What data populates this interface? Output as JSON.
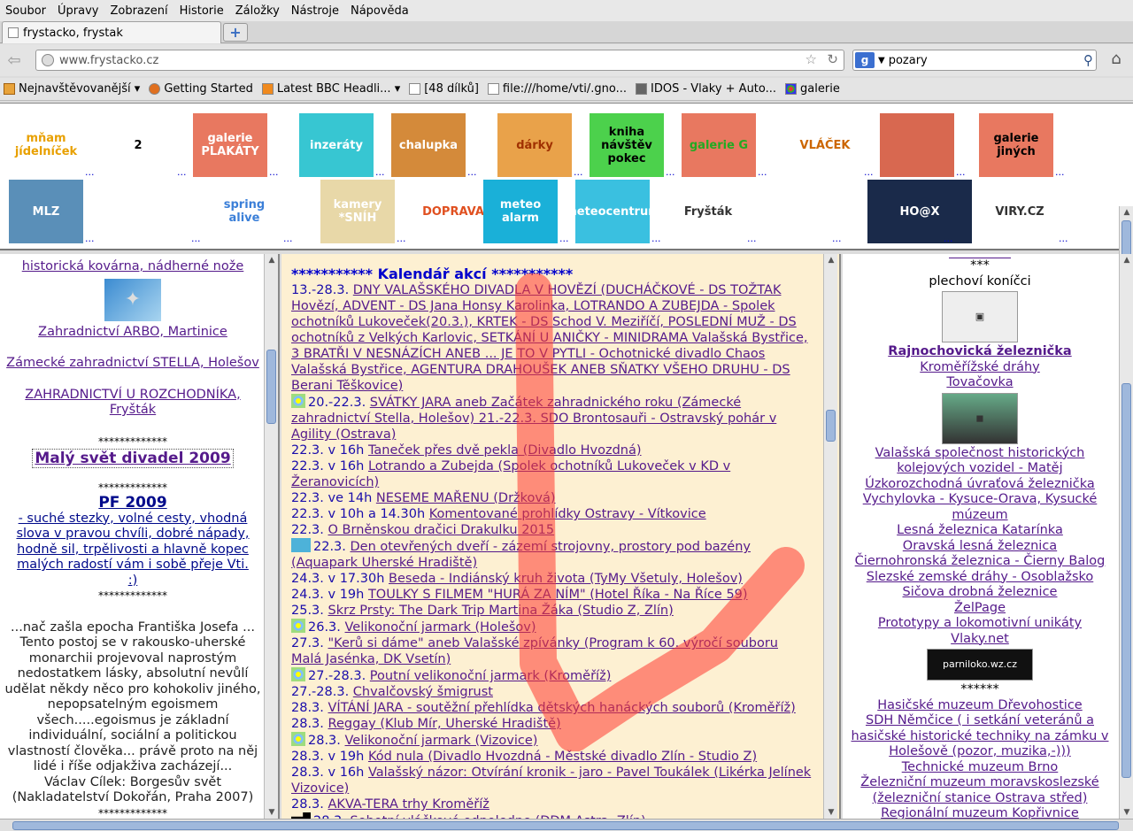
{
  "menu": [
    "Soubor",
    "Úpravy",
    "Zobrazení",
    "Historie",
    "Záložky",
    "Nástroje",
    "Nápověda"
  ],
  "tab": {
    "title": "frystacko, frystak",
    "new_tab": "+"
  },
  "nav": {
    "url": "www.frystacko.cz",
    "search_engine": "g",
    "search_query": "pozary"
  },
  "bookmarks": [
    {
      "label": "Nejnavštěvovanější ▾",
      "icon": "folder"
    },
    {
      "label": "Getting Started",
      "icon": "fox"
    },
    {
      "label": "Latest BBC Headli... ▾",
      "icon": "rss"
    },
    {
      "label": "[48 dílků]",
      "icon": "page"
    },
    {
      "label": "file:///home/vti/.gno...",
      "icon": "page"
    },
    {
      "label": "IDOS - Vlaky + Auto...",
      "icon": "idos"
    },
    {
      "label": "galerie",
      "icon": "gal"
    }
  ],
  "thumbs_row1": [
    {
      "label": "mňam jídelníček",
      "bg": "#ffffff",
      "fg": "#e8a000"
    },
    {
      "label": "2",
      "bg": "#ffffff",
      "fg": "#000"
    },
    {
      "label": "galerie PLAKÁTY",
      "bg": "#e87860",
      "fg": "#fff"
    },
    {
      "label": "inzeráty",
      "bg": "#37c6d2",
      "fg": "#fff"
    },
    {
      "label": "chalupka",
      "bg": "#d48a3a",
      "fg": "#fff"
    },
    {
      "label": "dárky",
      "bg": "#e9a24a",
      "fg": "#a03000"
    },
    {
      "label": "kniha návštěv pokec",
      "bg": "#4cd14c",
      "fg": "#000"
    },
    {
      "label": "galerie G",
      "bg": "#e87860",
      "fg": "#2a2"
    },
    {
      "label": "VLÁČEK",
      "bg": "#ffffff",
      "fg": "#c60"
    },
    {
      "label": "",
      "bg": "#d86850",
      "fg": "#fff"
    },
    {
      "label": "galerie jiných",
      "bg": "#e87860",
      "fg": "#000"
    }
  ],
  "thumbs_row2": [
    {
      "label": "MLZ",
      "bg": "#5a8fb8",
      "fg": "#fff"
    },
    {
      "label": "",
      "bg": "#ffffff",
      "fg": "#000"
    },
    {
      "label": "spring alive",
      "bg": "#ffffff",
      "fg": "#3b7fd8"
    },
    {
      "label": "kamery *SNÍH",
      "bg": "#e8d8a8",
      "fg": "#fff"
    },
    {
      "label": "DOPRAVA",
      "bg": "#ffffff",
      "fg": "#e05020"
    },
    {
      "label": "meteo alarm",
      "bg": "#1ab0d8",
      "fg": "#fff"
    },
    {
      "label": "meteocentrum",
      "bg": "#3ac0e0",
      "fg": "#fff"
    },
    {
      "label": "Fryšták",
      "bg": "#ffffff",
      "fg": "#333"
    },
    {
      "label": "",
      "bg": "#ffffff",
      "fg": "#e05020"
    },
    {
      "label": "HO@X",
      "bg": "#1a2a4a",
      "fg": "#fff"
    },
    {
      "label": "VIRY.CZ",
      "bg": "#ffffff",
      "fg": "#333"
    }
  ],
  "left": {
    "link1": "historická kovárna, nádherné nože",
    "link2": "Zahradnictví ARBO, Martinice",
    "link3": "Zámecké zahradnictví STELLA, Holešov",
    "link4": "ZAHRADNICTVÍ U ROZCHODNÍKA, Fryšták",
    "stars": "*************",
    "title1": "Malý svět divadel 2009",
    "title2": "PF 2009",
    "pf_text": "- suché stezky, volné cesty, vhodná slova v pravou chvíli, dobré nápady, hodně sil, trpělivosti a hlavně kopec malých radostí vám i sobě přeje Vti.",
    "smile": ":)",
    "quote": "...nač zašla epocha Františka Josefa ... Tento postoj se v rakousko-uherské monarchii projevoval naprostým nedostatkem lásky, absolutní nevůlí udělat někdy něco pro kohokoliv jiného, nepopsatelným egoismem všech.....egoismus je základní individuální, sociální a politickou vlastností člověka... právě proto na něj lidé i říše odjakživa zacházejí...",
    "author": "Václav Cílek: Borgesův svět (Nakladatelství Dokořán, Praha 2007)",
    "stars2": "*************"
  },
  "mid": {
    "heading": "*********** Kalendář akcí ***********",
    "events": [
      {
        "icon": "",
        "date": "13.-28.3.",
        "text": "DNY VALAŠSKÉHO DIVADLA V HOVĚZÍ (DUCHÁČKOVÉ - DS TOŽTAK Hovězí, ADVENT - DS Jana Honsy Karolinka, LOTRANDO A ZUBEJDA - Spolek ochotníků Lukoveček(20.3.), KRTEK - DS Schod V. Meziříčí, POSLEDNÍ MUŽ - DS ochotníků z Velkých Karlovic, SETKÁNÍ U ANIČKY - MINIDRAMA Valašská Bystřice, 3 BRATŘI V NESNÁZÍCH ANEB ... JE TO V PYTLI - Ochotnické divadlo Chaos Valašská Bystřice, AGENTURA DRAHOUŠEK ANEB SŇATKY VŠEHO DRUHU - DS Berani Těškovice)"
      },
      {
        "icon": "flower",
        "date": "20.-22.3.",
        "text": "SVÁTKY JARA aneb Začátek zahradnického roku (Zámecké zahradnictví Stella, Holešov) 21.-22.3. SDO Brontosauři - Ostravský pohár v Agility (Ostrava)"
      },
      {
        "icon": "",
        "date": "22.3. v 16h",
        "text": "Taneček přes dvě pekla (Divadlo Hvozdná)"
      },
      {
        "icon": "",
        "date": "22.3. v 16h",
        "text": "Lotrando a Zubejda (Spolek ochotníků Lukoveček v KD v Žeranovicích)"
      },
      {
        "icon": "",
        "date": "22.3. ve 14h",
        "text": "NESEME MAŘENU (Držková)"
      },
      {
        "icon": "",
        "date": "22.3. v 10h a 14.30h",
        "text": "Komentované prohlídky Ostravy - Vítkovice"
      },
      {
        "icon": "",
        "date": "22.3.",
        "text": "O Brněnskou dračici Drakulku 2015"
      },
      {
        "icon": "square",
        "date": "22.3.",
        "text": "Den otevřených dveří - zázemí strojovny, prostory pod bazény (Aquapark Uherské Hradiště)"
      },
      {
        "icon": "",
        "date": "24.3. v 17.30h",
        "text": "Beseda - Indiánský kruh života (TyMy Všetuly, Holešov)"
      },
      {
        "icon": "",
        "date": "24.3. v 19h",
        "text": "TOULKY S FILMEM \"HURÁ ZA NÍM\" (Hotel Říka - Na Říce 59)"
      },
      {
        "icon": "",
        "date": "25.3.",
        "text": "Skrz Prsty: The Dark Trip Martina Žáka (Studio Z, Zlín)"
      },
      {
        "icon": "flower",
        "date": "26.3.",
        "text": "Velikonoční jarmark (Holešov)"
      },
      {
        "icon": "",
        "date": "27.3.",
        "text": "\"Kerů si dáme\" aneb Valašské zpívánky (Program k 60. výročí souboru Malá Jasénka, DK Vsetín)"
      },
      {
        "icon": "flower",
        "date": "27.-28.3.",
        "text": "Poutní velikonoční jarmark (Kroměříž)"
      },
      {
        "icon": "",
        "date": "27.-28.3.",
        "text": "Chvalčovský šmigrust"
      },
      {
        "icon": "",
        "date": "28.3.",
        "text": "VÍTÁNÍ JARA - soutěžní přehlídka dětských hanáckých souborů (Kroměříž)"
      },
      {
        "icon": "",
        "date": "28.3.",
        "text": "Reggay (Klub Mír, Uherské Hradiště)"
      },
      {
        "icon": "flower",
        "date": "28.3.",
        "text": "Velikonoční jarmark (Vizovice)"
      },
      {
        "icon": "",
        "date": "28.3. v 19h",
        "text": "Kód nula (Divadlo Hvozdná - Městské divadlo Zlín - Studio Z)"
      },
      {
        "icon": "",
        "date": "28.3. v 16h",
        "text": "Valašský názor: Otvírání kronik - jaro - Pavel Toukálek (Likérka Jelínek Vizovice)"
      },
      {
        "icon": "",
        "date": "28.3.",
        "text": "AKVA-TERA trhy Kroměříž"
      },
      {
        "icon": "train",
        "date": "28.3.",
        "text": "Sobotní vláčkové odpoledne (DDM Astra, Zlín)"
      }
    ]
  },
  "right": {
    "stars": "***",
    "sub": "plechoví koníčci",
    "items": [
      {
        "text": "Rajnochovická železnička",
        "bold": true
      },
      {
        "text": "Kroměřížské dráhy",
        "bold": false
      },
      {
        "text": "Tovačovka",
        "bold": false
      },
      {
        "text": "Valašská společnost historických kolejových vozidel - Matěj",
        "bold": false
      },
      {
        "text": "Úzkorozchodná úvraťová železnička Vychylovka - Kysuce-Orava, Kysucké múzeum",
        "bold": false
      },
      {
        "text": "Lesná železnica Katarínka",
        "bold": false
      },
      {
        "text": "Oravská lesná železnica",
        "bold": false
      },
      {
        "text": "Čiernohronská železnica - Čierny Balog",
        "bold": false
      },
      {
        "text": "Slezské zemské dráhy - Osoblažsko",
        "bold": false
      },
      {
        "text": "Sičova drobná železnice",
        "bold": false
      },
      {
        "text": "ŽelPage",
        "bold": false
      },
      {
        "text": "Prototypy a lokomotivní unikáty",
        "bold": false
      },
      {
        "text": "Vlaky.net",
        "bold": false
      }
    ],
    "badge": "parniloko.wz.cz",
    "stars2": "******",
    "items2": [
      "Hasičské muzeum Dřevohostice",
      "SDH Němčice ( i setkání veteránů a hasičské historické techniky na zámku v Holešově (pozor, muzika,-)))",
      "Technické muzeum Brno",
      "Železniční muzeum moravskoslezské (železniční stanice Ostrava střed)",
      "Regionální muzeum Kopřivnice"
    ]
  },
  "colors": {
    "mid_bg": "#fdf0d2",
    "link": "#551a8b",
    "heading": "#0000cc",
    "arrow": "#ff3b2f"
  }
}
